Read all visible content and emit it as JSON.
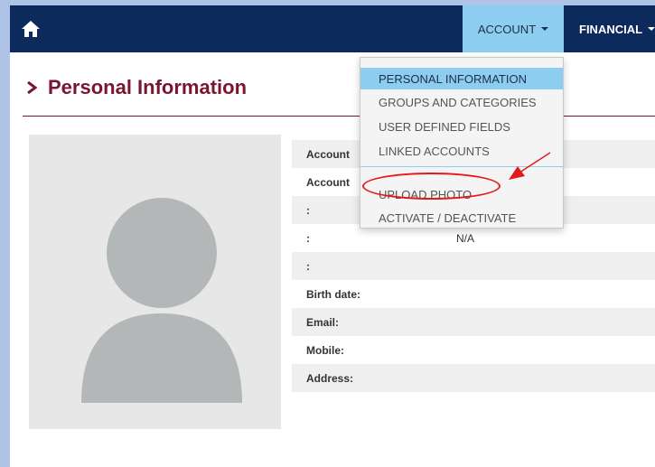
{
  "navbar": {
    "home_icon": "home-icon",
    "account_label": "ACCOUNT",
    "financial_label": "FINANCIAL"
  },
  "page": {
    "title": "Personal Information"
  },
  "account_menu": {
    "items": [
      {
        "label": "PERSONAL INFORMATION",
        "active": true
      },
      {
        "label": "GROUPS AND CATEGORIES",
        "active": false
      },
      {
        "label": "USER DEFINED FIELDS",
        "active": false
      },
      {
        "label": "LINKED ACCOUNTS",
        "active": false
      },
      {
        "label": "UPLOAD PHOTO",
        "active": false,
        "highlighted": true
      },
      {
        "label": "ACTIVATE / DEACTIVATE",
        "active": false
      }
    ]
  },
  "profile": {
    "avatar": "avatar-placeholder-icon",
    "rows": [
      {
        "label": "Account",
        "value": ""
      },
      {
        "label": "Account",
        "value": ""
      },
      {
        "label": ":",
        "value": ""
      },
      {
        "label": ":",
        "value": "N/A"
      },
      {
        "label": ":",
        "value": ""
      },
      {
        "label": "Birth date:",
        "value": ""
      },
      {
        "label": "Email:",
        "value": ""
      },
      {
        "label": "Mobile:",
        "value": ""
      },
      {
        "label": "Address:",
        "value": ""
      }
    ]
  },
  "colors": {
    "navbar": "#0c2a5b",
    "active_menu": "#8dcdf0",
    "title": "#7a1530",
    "annotation": "#e31a1a",
    "outer_background": "#aec3e6"
  }
}
